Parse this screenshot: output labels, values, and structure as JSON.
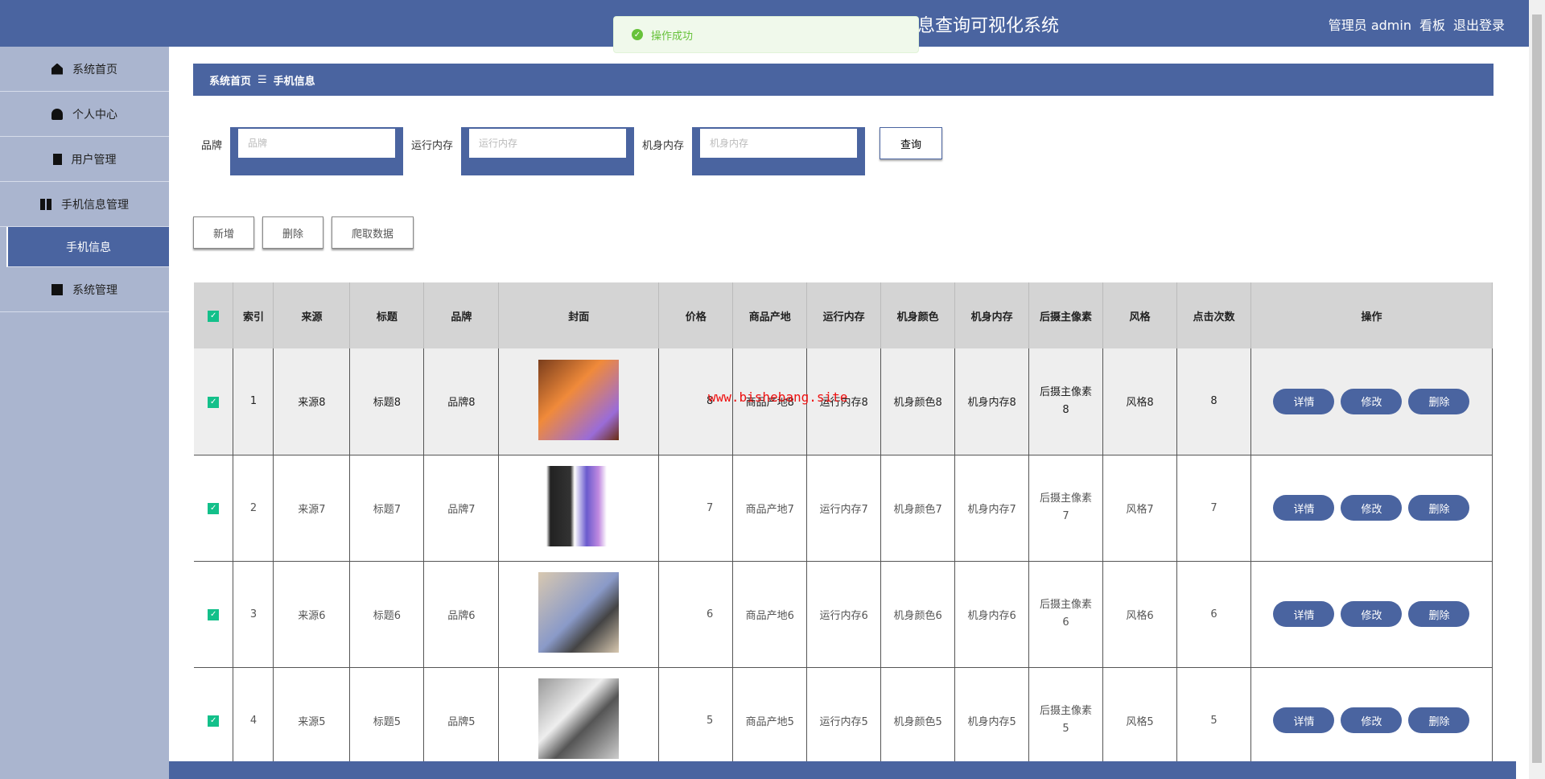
{
  "header": {
    "title_visible": "息查询可视化系统",
    "user": "管理员 admin",
    "board": "看板",
    "logout": "退出登录"
  },
  "toast": {
    "message": "操作成功",
    "status_color": "#67c23a"
  },
  "sidebar": {
    "items": [
      {
        "label": "系统首页",
        "icon": "home-icon"
      },
      {
        "label": "个人中心",
        "icon": "user-icon"
      },
      {
        "label": "用户管理",
        "icon": "clipboard-icon"
      },
      {
        "label": "手机信息管理",
        "icon": "grid-icon"
      },
      {
        "label": "手机信息",
        "sub": true,
        "active": true
      },
      {
        "label": "系统管理",
        "icon": "chart-icon"
      }
    ]
  },
  "breadcrumb": {
    "home": "系统首页",
    "sep": "☰",
    "current": "手机信息"
  },
  "search": {
    "brand_label": "品牌",
    "brand_placeholder": "品牌",
    "ram_label": "运行内存",
    "ram_placeholder": "运行内存",
    "storage_label": "机身内存",
    "storage_placeholder": "机身内存",
    "query": "查询"
  },
  "actions": {
    "add": "新增",
    "delete": "删除",
    "crawl": "爬取数据"
  },
  "table": {
    "headers": [
      "索引",
      "来源",
      "标题",
      "品牌",
      "封面",
      "价格",
      "商品产地",
      "运行内存",
      "机身颜色",
      "机身内存",
      "后摄主像素",
      "风格",
      "点击次数",
      "操作"
    ],
    "rows": [
      {
        "idx": "1",
        "source": "来源8",
        "title": "标题8",
        "brand": "品牌8",
        "price": "8",
        "origin": "商品产地8",
        "ram": "运行内存8",
        "color": "机身颜色8",
        "storage": "机身内存8",
        "camera": "后摄主像素8",
        "style": "风格8",
        "clicks": "8"
      },
      {
        "idx": "2",
        "source": "来源7",
        "title": "标题7",
        "brand": "品牌7",
        "price": "7",
        "origin": "商品产地7",
        "ram": "运行内存7",
        "color": "机身颜色7",
        "storage": "机身内存7",
        "camera": "后摄主像素7",
        "style": "风格7",
        "clicks": "7"
      },
      {
        "idx": "3",
        "source": "来源6",
        "title": "标题6",
        "brand": "品牌6",
        "price": "6",
        "origin": "商品产地6",
        "ram": "运行内存6",
        "color": "机身颜色6",
        "storage": "机身内存6",
        "camera": "后摄主像素6",
        "style": "风格6",
        "clicks": "6"
      },
      {
        "idx": "4",
        "source": "来源5",
        "title": "标题5",
        "brand": "品牌5",
        "price": "5",
        "origin": "商品产地5",
        "ram": "运行内存5",
        "color": "机身颜色5",
        "storage": "机身内存5",
        "camera": "后摄主像素5",
        "style": "风格5",
        "clicks": "5"
      }
    ],
    "row_buttons": {
      "detail": "详情",
      "edit": "修改",
      "delete": "删除"
    }
  },
  "watermark": "www.bishebang.site",
  "colors": {
    "primary": "#4a64a0",
    "check": "#13c08a"
  }
}
